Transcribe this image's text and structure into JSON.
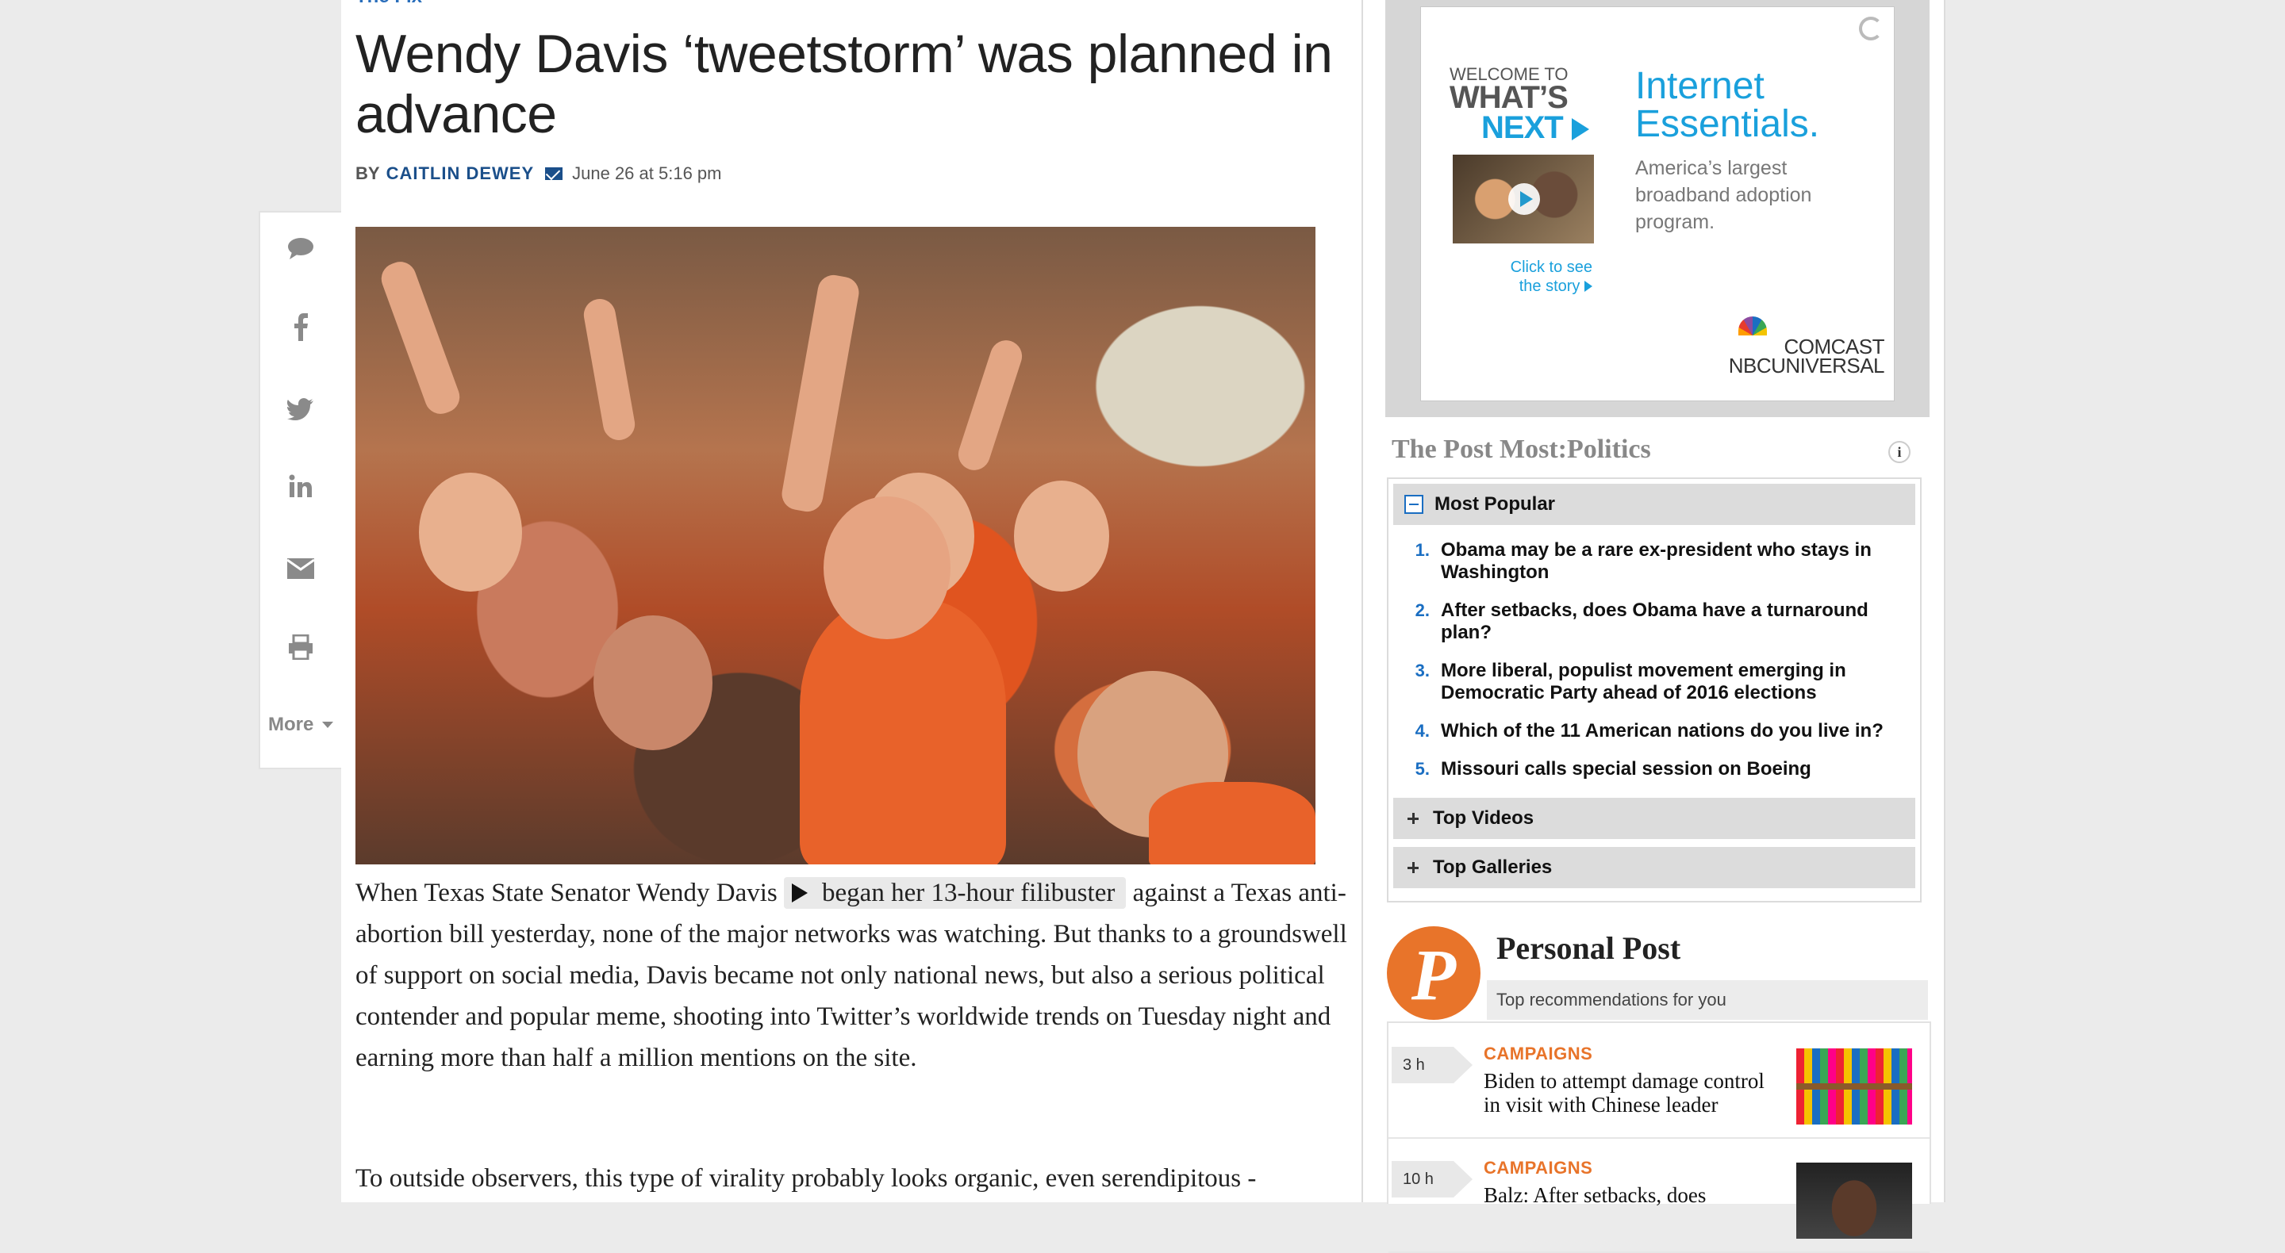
{
  "article": {
    "kicker": "The Fix",
    "headline": "Wendy Davis ‘tweetstorm’ was planned in advance",
    "byline_prefix": "BY",
    "author": "CAITLIN DEWEY",
    "date": "June 26 at 5:16 pm",
    "paragraph1_before": "When Texas State Senator Wendy Davis",
    "video_link": "began her 13-hour filibuster",
    "paragraph1_after": "against a Texas anti-abortion bill yesterday, none of the major networks was watching. But thanks to a groundswell of support on social media, Davis became not only national news, but also a serious political contender and popular meme, shooting into Twitter’s worldwide trends on Tuesday night and earning more than half a million mentions on the site.",
    "paragraph2": "To outside observers, this type of virality probably looks organic, even serendipitous -"
  },
  "share_rail": {
    "icons": [
      "comment-icon",
      "facebook-icon",
      "twitter-icon",
      "linkedin-icon",
      "email-icon",
      "print-icon"
    ],
    "more_label": "More"
  },
  "ad": {
    "welcome": "WELCOME TO",
    "whats": "WHAT’S",
    "next": "NEXT",
    "click_text": "Click to see the story",
    "headline": "Internet Essentials.",
    "subtext": "America’s largest broadband adoption program.",
    "brand_line1": "COMCAST",
    "brand_line2": "NBCUNIVERSAL",
    "accent_color": "#1aa0dc"
  },
  "post_most": {
    "title": "The Post Most:Politics",
    "info_glyph": "i",
    "tabs": {
      "most_popular": "Most Popular",
      "top_videos": "Top Videos",
      "top_galleries": "Top Galleries"
    },
    "items": [
      {
        "num": "1.",
        "text": "Obama may be a rare ex-president who stays in Washington"
      },
      {
        "num": "2.",
        "text": "After setbacks, does Obama have a turnaround plan?"
      },
      {
        "num": "3.",
        "text": "More liberal, populist movement emerging in Democratic Party ahead of 2016 elections"
      },
      {
        "num": "4.",
        "text": "Which of the 11 American nations do you live in?"
      },
      {
        "num": "5.",
        "text": "Missouri calls special session on Boeing"
      }
    ]
  },
  "personal_post": {
    "logo_letter": "P",
    "title": "Personal Post",
    "subtitle": "Top recommendations for you",
    "items": [
      {
        "time": "3 h",
        "category": "CAMPAIGNS",
        "headline": "Biden to attempt damage control in visit with Chinese leader"
      },
      {
        "time": "10 h",
        "category": "CAMPAIGNS",
        "headline": "Balz: After setbacks, does"
      }
    ]
  },
  "colors": {
    "link_blue": "#1b4f8a",
    "list_number_blue": "#1a6ec2",
    "personal_post_orange": "#e8742a"
  }
}
